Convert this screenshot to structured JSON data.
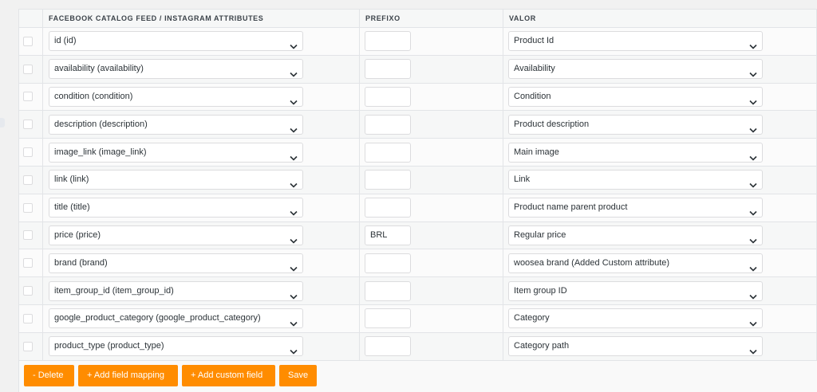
{
  "table": {
    "headers": {
      "attribute": "FACEBOOK CATALOG FEED / INSTAGRAM ATTRIBUTES",
      "prefix": "PREFIXO",
      "value": "VALOR"
    },
    "rows": [
      {
        "attribute": "id (id)",
        "prefix": "",
        "value": "Product Id"
      },
      {
        "attribute": "availability (availability)",
        "prefix": "",
        "value": "Availability"
      },
      {
        "attribute": "condition (condition)",
        "prefix": "",
        "value": "Condition"
      },
      {
        "attribute": "description (description)",
        "prefix": "",
        "value": "Product description"
      },
      {
        "attribute": "image_link (image_link)",
        "prefix": "",
        "value": "Main image"
      },
      {
        "attribute": "link (link)",
        "prefix": "",
        "value": "Link"
      },
      {
        "attribute": "title (title)",
        "prefix": "",
        "value": "Product name parent product"
      },
      {
        "attribute": "price (price)",
        "prefix": "BRL",
        "value": "Regular price"
      },
      {
        "attribute": "brand (brand)",
        "prefix": "",
        "value": "woosea brand (Added Custom attribute)"
      },
      {
        "attribute": "item_group_id (item_group_id)",
        "prefix": "",
        "value": "Item group ID"
      },
      {
        "attribute": "google_product_category (google_product_category)",
        "prefix": "",
        "value": "Category"
      },
      {
        "attribute": "product_type (product_type)",
        "prefix": "",
        "value": "Category path"
      }
    ]
  },
  "actions": {
    "delete": "- Delete",
    "add_field_mapping": "+ Add field mapping",
    "add_custom_field": "+ Add custom field",
    "save": "Save"
  },
  "colors": {
    "button": "#ff8c00",
    "border": "#dcdcde"
  }
}
